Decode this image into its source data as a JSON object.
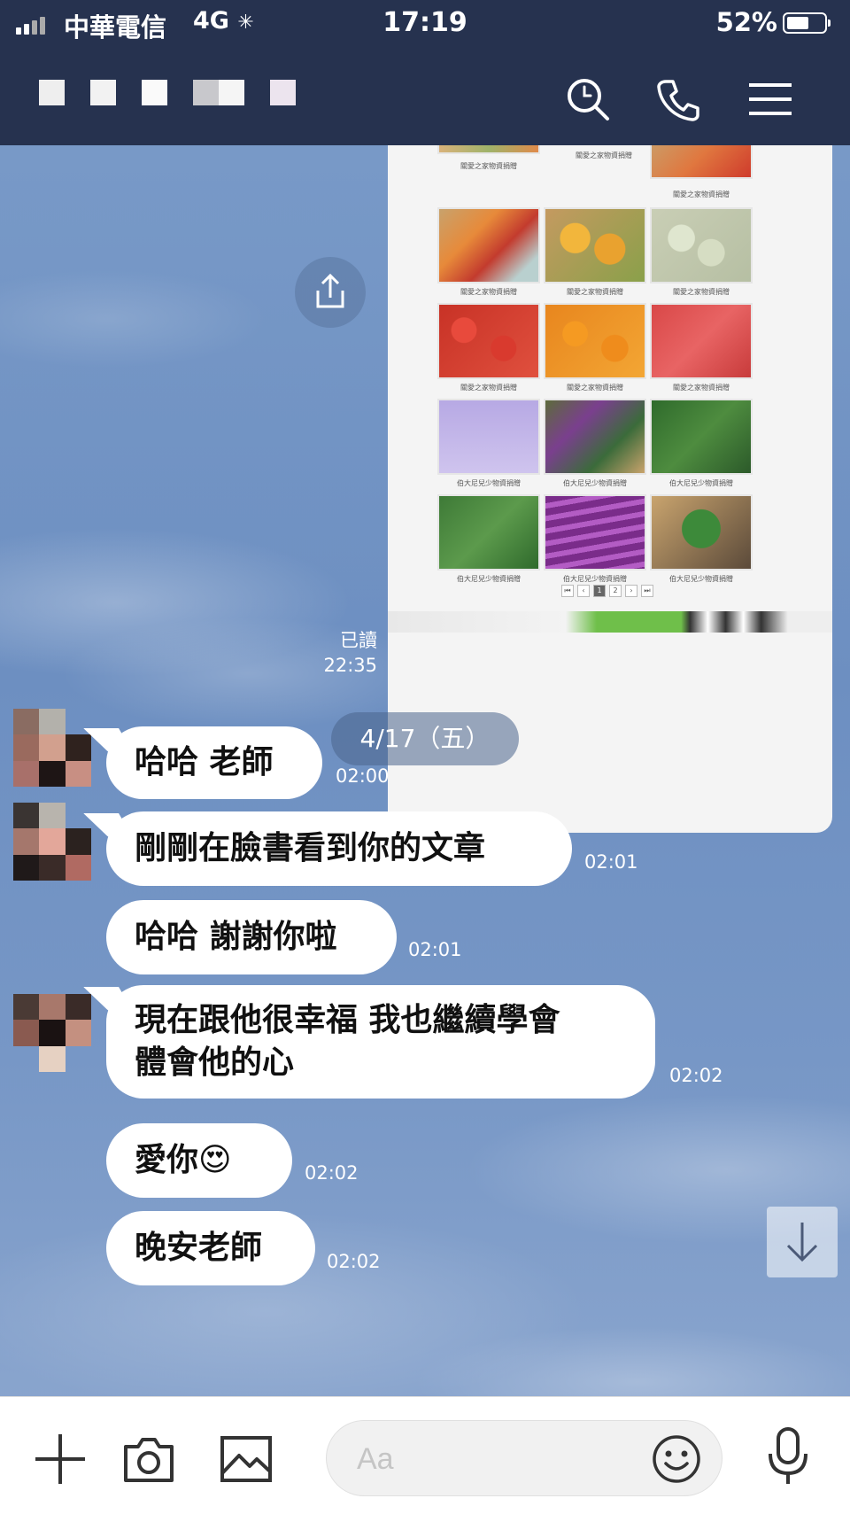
{
  "status_bar": {
    "carrier": "中華電信",
    "network": "4G",
    "time": "17:19",
    "battery_percent": "52%",
    "battery_level": 0.52
  },
  "header": {
    "contact_name_redacted": true,
    "search_icon": "search-icon",
    "call_icon": "phone-icon",
    "menu_icon": "hamburger-menu-icon"
  },
  "shared_image": {
    "caption_top": "關愛之家物資捐贈",
    "caption_bottom": "伯大尼兒少物資捐贈",
    "pages": [
      "1",
      "2"
    ],
    "read_label": "已讀",
    "time": "22:35"
  },
  "date_separator": "4/17（五）",
  "messages": [
    {
      "text": "哈哈 老師",
      "time": "02:00"
    },
    {
      "text": "剛剛在臉書看到你的文章",
      "time": "02:01"
    },
    {
      "text": "哈哈 謝謝你啦",
      "time": "02:01"
    },
    {
      "line1": "現在跟他很幸福 我也繼續學會",
      "line2": "體會他的心",
      "time": "02:02"
    },
    {
      "text": "愛你",
      "emoji": "😍",
      "time": "02:02"
    },
    {
      "text": "晚安老師",
      "time": "02:02"
    }
  ],
  "input_bar": {
    "placeholder": "Aa",
    "icons": [
      "plus-icon",
      "camera-icon",
      "image-icon",
      "emoji-icon",
      "microphone-icon"
    ]
  }
}
